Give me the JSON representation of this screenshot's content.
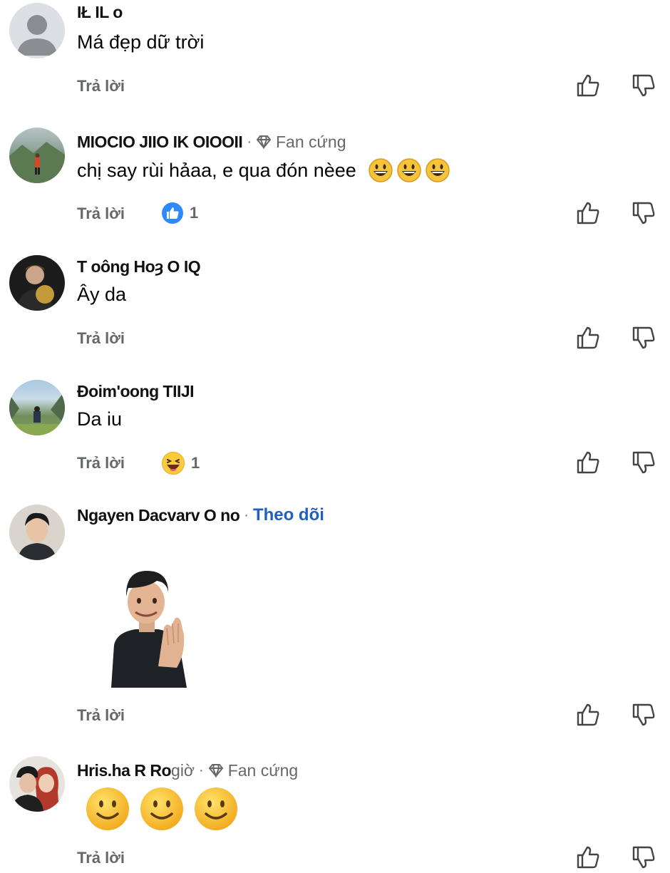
{
  "comments": [
    {
      "name": "IŁ IL         o",
      "text": "Má đẹp dữ trời",
      "reply": "Trả lời",
      "avatar": "default-avatar"
    },
    {
      "name": "MIOCIO JIIO IK OIOOII",
      "separator": "·",
      "badge": "Fan cứng",
      "text": "chị say rùi hảaa, e qua đón nèee",
      "reply": "Trả lời",
      "reaction_count": "1",
      "avatar": "mountain-avatar"
    },
    {
      "name": "T oông Hoȝ O IQ",
      "text": "Ây da",
      "reply": "Trả lời",
      "avatar": "man-dark-avatar"
    },
    {
      "name": "Đoim'oong TIIJI",
      "text": "Da iu",
      "reply": "Trả lời",
      "reaction_count": "1",
      "avatar": "valley-avatar"
    },
    {
      "name": "Ngayen Dacvarv O    no",
      "separator": "·",
      "follow": "Theo dõi",
      "reply": "Trả lời",
      "avatar": "young-man-avatar"
    },
    {
      "name": "Hris.ha R Ro",
      "time": "giờ",
      "separator": "·",
      "badge": "Fan cứng",
      "reply": "Trả lời",
      "avatar": "couple-avatar"
    }
  ]
}
